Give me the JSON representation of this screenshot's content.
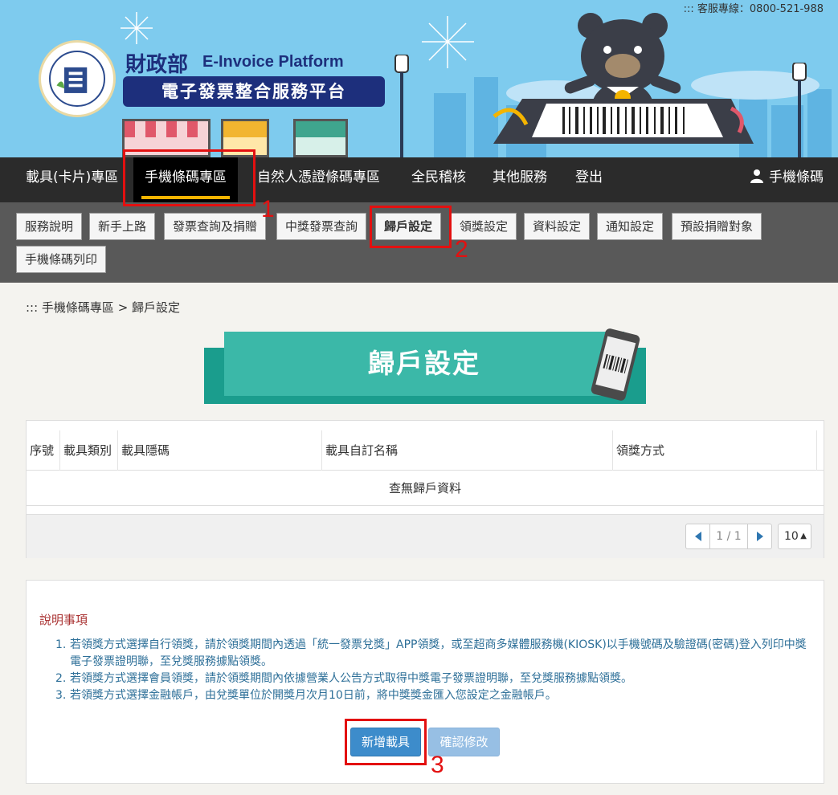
{
  "header": {
    "hotline": "::: 客服專線：0800-521-988",
    "title_zh": "財政部",
    "title_en": "E-Invoice Platform",
    "subtitle": "電子發票整合服務平台",
    "brand_color": "#1d2f7c",
    "sky_color": "#7ecbee"
  },
  "main_nav": {
    "items": [
      {
        "label": "載具(卡片)專區"
      },
      {
        "label": "手機條碼專區",
        "active": true
      },
      {
        "label": "自然人憑證條碼專區"
      },
      {
        "label": "全民稽核"
      },
      {
        "label": "其他服務"
      },
      {
        "label": "登出"
      }
    ],
    "user_label": "手機條碼",
    "active_underline_color": "#f4b400"
  },
  "sub_nav": {
    "items": [
      {
        "label": "服務說明"
      },
      {
        "label": "新手上路"
      },
      {
        "label": "發票查詢及捐贈"
      },
      {
        "label": "中獎發票查詢"
      },
      {
        "label": "歸戶設定",
        "active": true
      },
      {
        "label": "領獎設定"
      },
      {
        "label": "資料設定"
      },
      {
        "label": "通知設定"
      },
      {
        "label": "預設捐贈對象"
      },
      {
        "label": "手機條碼列印"
      }
    ]
  },
  "breadcrumb": "::: 手機條碼專區 > 歸戶設定",
  "page_title": "歸戶設定",
  "table": {
    "columns": [
      "序號",
      "載具類別",
      "載具隱碼",
      "載具自訂名稱",
      "領獎方式"
    ],
    "empty_text": "查無歸戶資料",
    "pager": {
      "text": "1 / 1"
    },
    "page_size": "10"
  },
  "notes": {
    "title": "說明事項",
    "items": [
      {
        "num": "1.",
        "text": "若領獎方式選擇自行領獎，請於領獎期間內透過「統一發票兌獎」APP領獎，或至超商多媒體服務機(KIOSK)以手機號碼及驗證碼(密碼)登入列印中獎電子發票證明聯，至兌獎服務據點領獎。"
      },
      {
        "num": "2.",
        "text": "若領獎方式選擇會員領獎，請於領獎期間內依據營業人公告方式取得中獎電子發票證明聯，至兌獎服務據點領獎。"
      },
      {
        "num": "3.",
        "text": "若領獎方式選擇金融帳戶，由兌獎單位於開獎月次月10日前，將中獎獎金匯入您設定之金融帳戶。"
      }
    ],
    "text_color": "#2d6f98",
    "title_color": "#aa3333"
  },
  "buttons": {
    "add": "新增載具",
    "confirm": "確認修改"
  },
  "annotations": {
    "labels": [
      "1",
      "2",
      "3"
    ],
    "color": "#e31010"
  }
}
